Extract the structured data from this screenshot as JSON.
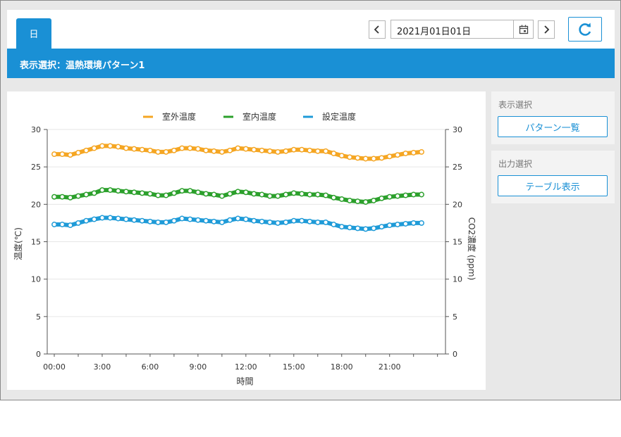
{
  "header": {
    "tab_day": "日",
    "date": "2021月01日01日",
    "banner": "表示選択：温熱環境パターン1"
  },
  "side": {
    "display_title": "表示選択",
    "pattern_button": "パターン一覧",
    "output_title": "出力選択",
    "table_button": "テーブル表示"
  },
  "colors": {
    "accent": "#1a90d5",
    "outdoor": "#f5a623",
    "indoor": "#2ca02c",
    "setting": "#1f9bd8"
  },
  "chart_data": {
    "type": "line",
    "xlabel": "時間",
    "ylabel": "温度(℃)",
    "ylabel_right": "CO2濃度 (ppm)",
    "ylim": [
      0,
      30
    ],
    "y2lim": [
      0,
      30
    ],
    "yticks": [
      "0",
      "5",
      "10",
      "15",
      "20",
      "25",
      "30"
    ],
    "xticks": [
      "00:00",
      "3:00",
      "6:00",
      "9:00",
      "12:00",
      "15:00",
      "18:00",
      "21:00"
    ],
    "grid": true,
    "legend": "top-center",
    "x": [
      0,
      0.5,
      1,
      1.5,
      2,
      2.5,
      3,
      3.5,
      4,
      4.5,
      5,
      5.5,
      6,
      6.5,
      7,
      7.5,
      8,
      8.5,
      9,
      9.5,
      10,
      10.5,
      11,
      11.5,
      12,
      12.5,
      13,
      13.5,
      14,
      14.5,
      15,
      15.5,
      16,
      16.5,
      17,
      17.5,
      18,
      18.5,
      19,
      19.5,
      20,
      20.5,
      21,
      21.5,
      22,
      22.5,
      23
    ],
    "series": [
      {
        "name": "室外温度",
        "color": "#f5a623",
        "values": [
          26.7,
          26.7,
          26.6,
          26.9,
          27.2,
          27.5,
          27.8,
          27.8,
          27.7,
          27.5,
          27.4,
          27.3,
          27.2,
          27.0,
          27.0,
          27.2,
          27.5,
          27.5,
          27.4,
          27.2,
          27.1,
          27.0,
          27.2,
          27.5,
          27.4,
          27.3,
          27.2,
          27.1,
          27.0,
          27.1,
          27.3,
          27.3,
          27.2,
          27.1,
          27.1,
          26.8,
          26.5,
          26.3,
          26.2,
          26.1,
          26.1,
          26.2,
          26.4,
          26.6,
          26.8,
          26.9,
          27.0
        ]
      },
      {
        "name": "室内温度",
        "color": "#2ca02c",
        "values": [
          21.0,
          21.0,
          20.9,
          21.1,
          21.3,
          21.5,
          21.9,
          21.9,
          21.8,
          21.7,
          21.6,
          21.5,
          21.4,
          21.2,
          21.2,
          21.5,
          21.8,
          21.8,
          21.6,
          21.4,
          21.3,
          21.1,
          21.4,
          21.7,
          21.6,
          21.4,
          21.3,
          21.1,
          21.1,
          21.3,
          21.5,
          21.4,
          21.3,
          21.3,
          21.2,
          20.9,
          20.7,
          20.5,
          20.4,
          20.3,
          20.5,
          20.8,
          21.0,
          21.1,
          21.2,
          21.3,
          21.3
        ]
      },
      {
        "name": "設定温度",
        "color": "#1f9bd8",
        "values": [
          17.3,
          17.3,
          17.2,
          17.5,
          17.8,
          18.0,
          18.2,
          18.2,
          18.1,
          18.0,
          17.9,
          17.8,
          17.7,
          17.6,
          17.6,
          17.8,
          18.1,
          18.0,
          17.9,
          17.8,
          17.7,
          17.6,
          17.9,
          18.1,
          18.0,
          17.8,
          17.7,
          17.6,
          17.5,
          17.6,
          17.8,
          17.8,
          17.7,
          17.6,
          17.6,
          17.3,
          17.0,
          16.9,
          16.8,
          16.7,
          16.8,
          17.0,
          17.2,
          17.3,
          17.4,
          17.5,
          17.5
        ]
      }
    ]
  }
}
